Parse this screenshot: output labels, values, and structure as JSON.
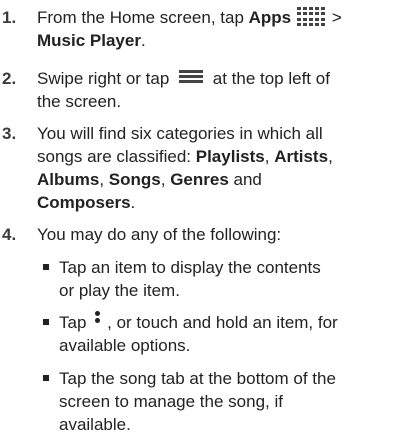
{
  "steps": [
    {
      "num": "1.",
      "a": "From the Home screen, tap ",
      "b": "Apps",
      "c": " >",
      "d": "Music Player",
      "e": "."
    },
    {
      "num": "2.",
      "a": "Swipe right or tap ",
      "c": " at the top left of",
      "d": "the screen."
    },
    {
      "num": "3.",
      "a": "You will find six categories in which all",
      "b": "songs are classified: ",
      "c": "Playlists",
      "d": ", ",
      "e": "Artists",
      "f": ",",
      "g": "Albums",
      "h": ", ",
      "i": "Songs",
      "j": ", ",
      "k": "Genres",
      "l": " and",
      "m": "Composers",
      "n": "."
    },
    {
      "num": "4.",
      "a": "You may do any of the following:"
    }
  ],
  "bullets": [
    {
      "l1": "Tap an item to display the contents",
      "l2": "or play the item."
    },
    {
      "a": "Tap ",
      "b": ", or touch and hold an item, for",
      "l2": "available options."
    },
    {
      "l1": "Tap the song tab at the bottom of the",
      "l2": "screen to manage the song, if",
      "l3": "available."
    }
  ],
  "icons": [
    "apps-grid-icon",
    "menu-icon",
    "more-options-icon"
  ]
}
